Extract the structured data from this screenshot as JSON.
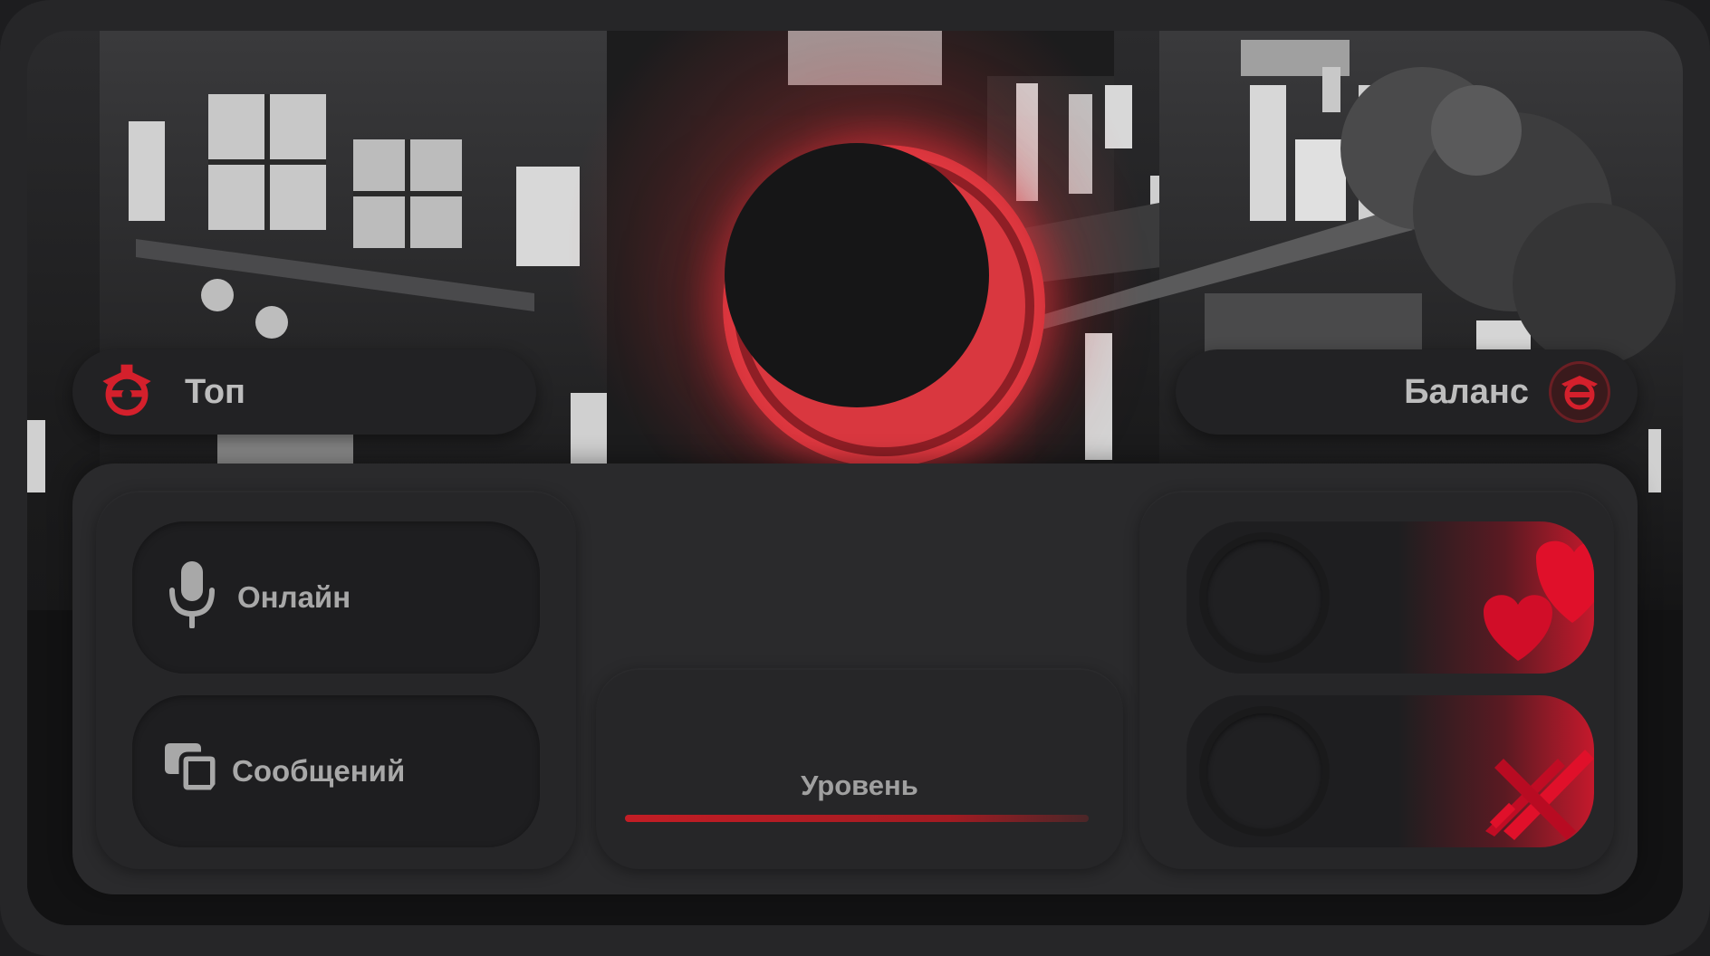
{
  "top_pill": {
    "label": "Топ",
    "icon": "clan-emblem-icon"
  },
  "balance_pill": {
    "label": "Баланс",
    "icon": "clan-emblem-icon"
  },
  "stats": {
    "online": {
      "label": "Онлайн",
      "icon": "microphone-icon"
    },
    "messages": {
      "label": "Сообщений",
      "icon": "chat-bubbles-icon"
    }
  },
  "level": {
    "label": "Уровень",
    "progress": 1.0
  },
  "features": [
    {
      "name": "likes",
      "icon": "hearts-icon"
    },
    {
      "name": "weapons",
      "icon": "crossed-swords-icon"
    }
  ],
  "colors": {
    "accent": "#e63b43",
    "accent_dark": "#c31d25",
    "panel": "#2a2a2c",
    "text": "#bdbdbd"
  }
}
